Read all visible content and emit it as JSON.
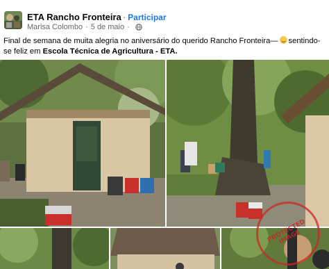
{
  "post": {
    "group_name": "ETA Rancho Fronteira",
    "separator": "·",
    "join_label": "Participar",
    "author": "Marisa Colombo",
    "date": "5 de maio",
    "text_part1": "Final de semana de muita alegria no aniversário do querido Rancho Fronteira—",
    "text_part2": "sentindo-se feliz em",
    "text_bold": "Escola Técnica de Agricultura - ETA.",
    "emoji_name": "smiling-face-icon",
    "privacy_icon": "globe-icon",
    "watermark_text": "PROTECTED IMAGE",
    "colors": {
      "link": "#1877f2",
      "meta": "#65676b",
      "watermark": "#c82828"
    }
  }
}
